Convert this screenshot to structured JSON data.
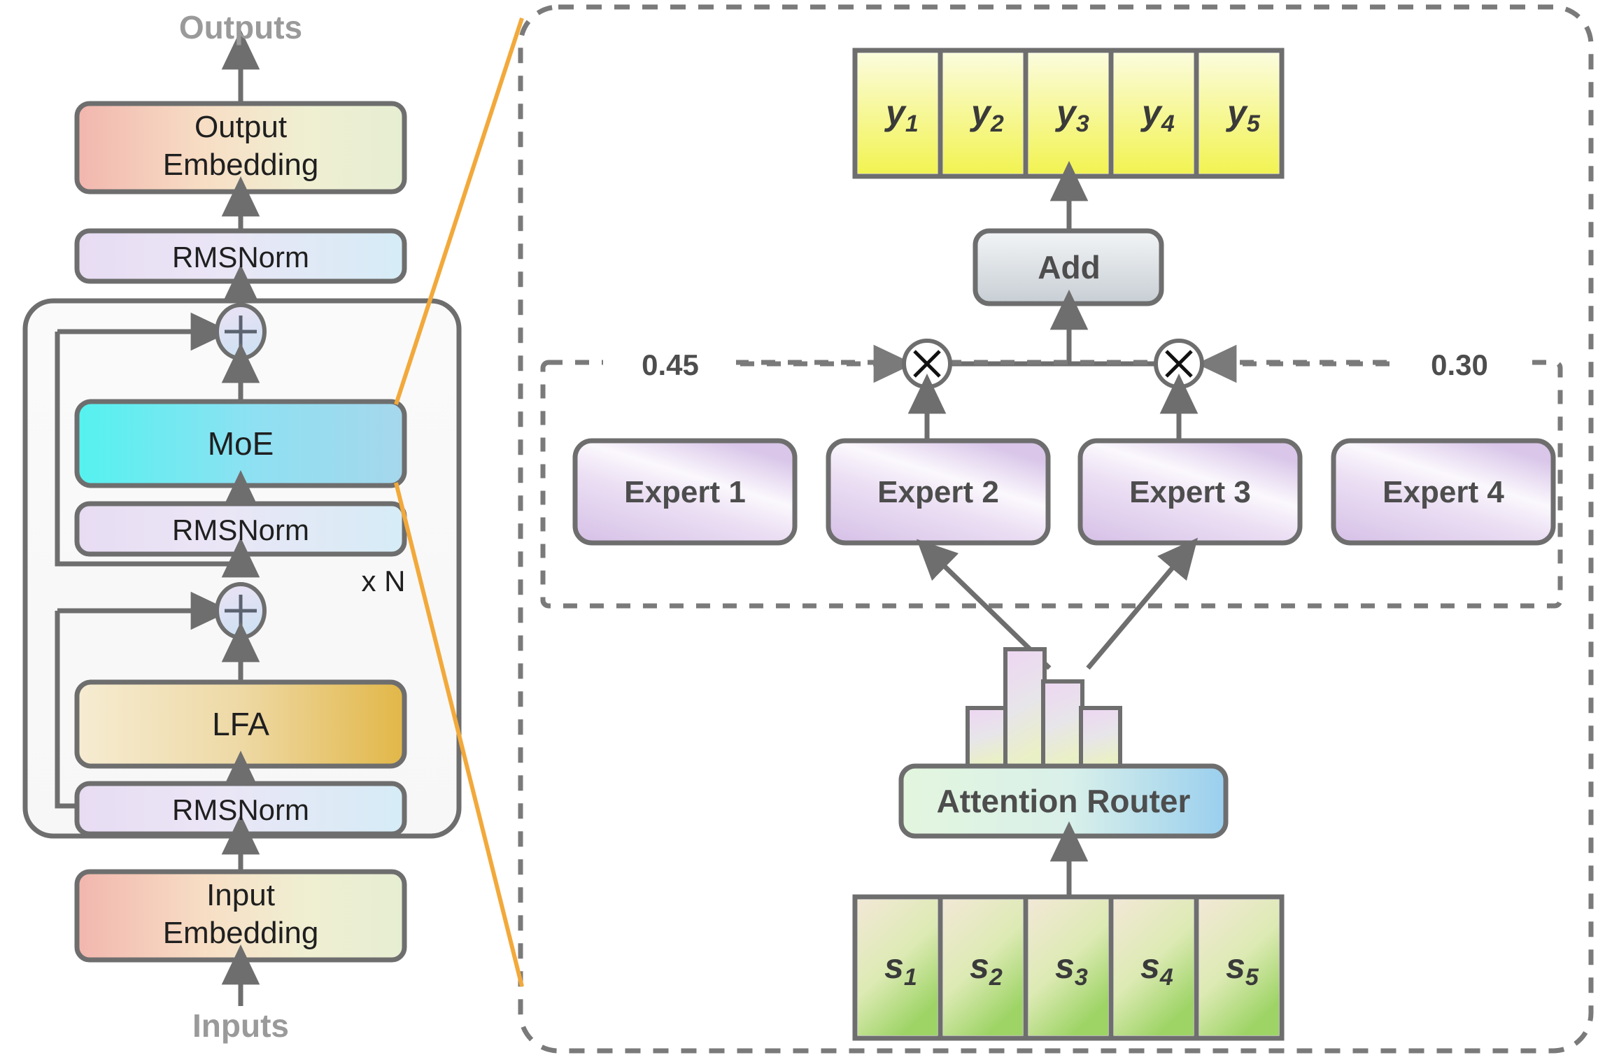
{
  "diagram": {
    "title_hidden": "Transformer with Mixture-of-Experts and Attention Router",
    "left_panel": {
      "top_label": "Outputs",
      "bottom_label": "Inputs",
      "repeat_label": "x N",
      "blocks": [
        {
          "id": "output-embedding",
          "label_line1": "Output",
          "label_line2": "Embedding"
        },
        {
          "id": "rmsnorm-top",
          "label": "RMSNorm"
        },
        {
          "id": "moe",
          "label": "MoE"
        },
        {
          "id": "rmsnorm-mid",
          "label": "RMSNorm"
        },
        {
          "id": "lfa",
          "label": "LFA"
        },
        {
          "id": "rmsnorm-bottom",
          "label": "RMSNorm"
        },
        {
          "id": "input-embedding",
          "label_line1": "Input",
          "label_line2": "Embedding"
        }
      ],
      "residual_add_symbol": "+"
    },
    "right_panel": {
      "output_tokens": [
        "y",
        "y",
        "y",
        "y",
        "y"
      ],
      "output_token_subs": [
        "1",
        "2",
        "3",
        "4",
        "5"
      ],
      "input_tokens": [
        "s",
        "s",
        "s",
        "s",
        "s"
      ],
      "input_token_subs": [
        "1",
        "2",
        "3",
        "4",
        "5"
      ],
      "add_label": "Add",
      "multiply_symbol": "×",
      "router_label": "Attention Router",
      "experts": [
        "Expert 1",
        "Expert 2",
        "Expert 3",
        "Expert 4"
      ],
      "gate_weights": {
        "left": "0.45",
        "right": "0.30"
      },
      "router_histogram": {
        "values": [
          0.42,
          1.0,
          0.76,
          0.42
        ],
        "bar_count": 4
      }
    },
    "colors": {
      "stroke": "#6e6e6e",
      "dashed_stroke": "#7a7a7a",
      "connector_orange": "#f2a93b",
      "muted_text": "#9a9a9a",
      "dark_text": "#4d4d4d",
      "moe_from": "#5ff2ef",
      "moe_to": "#9fd8ec",
      "lfa_from": "#f6ecd3",
      "lfa_to": "#e4b košík"
    }
  }
}
